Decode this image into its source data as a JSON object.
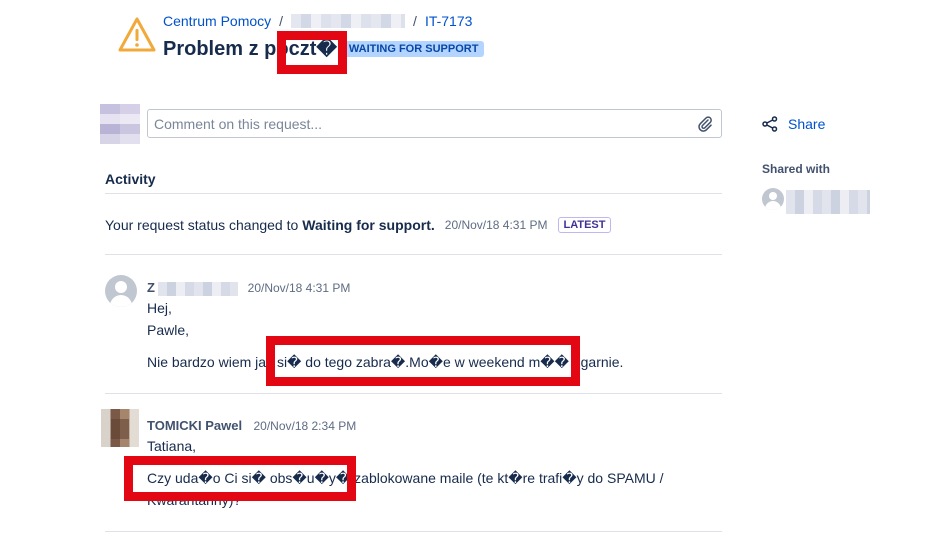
{
  "header": {
    "breadcrumbs": {
      "portal": "Centrum Pomocy",
      "separator": "/",
      "issue_key": "IT-7173"
    },
    "title": "Problem z poczt�",
    "status": "WAITING FOR SUPPORT"
  },
  "composer": {
    "placeholder": "Comment on this request..."
  },
  "activity": {
    "heading": "Activity",
    "status_change": {
      "prefix": "Your request status changed to",
      "status": "Waiting for support.",
      "time": "20/Nov/18 4:31 PM",
      "badge": "LATEST"
    },
    "comments": [
      {
        "author_initial": "Z",
        "time": "20/Nov/18 4:31 PM",
        "lines": [
          "Hej,",
          "Pawle,",
          "Nie bardzo wiem jak si� do tego zabra�.Mo�e w weekend m�� ogarnie."
        ]
      },
      {
        "author": "TOMICKI Pawel",
        "time": "20/Nov/18 2:34 PM",
        "lines": [
          "Tatiana,",
          "Czy uda�o Ci si� obs�u�y� zablokowane maile (te kt�re trafi�y do SPAMU /",
          "Kwarantanny)?"
        ]
      }
    ]
  },
  "sidebar": {
    "share_label": "Share",
    "shared_with_label": "Shared with"
  },
  "colors": {
    "link": "#0052cc",
    "status_lozenge_bg": "#b3d4ff",
    "warning_icon": "#f2a93b",
    "redaction_box": "#e30613"
  }
}
